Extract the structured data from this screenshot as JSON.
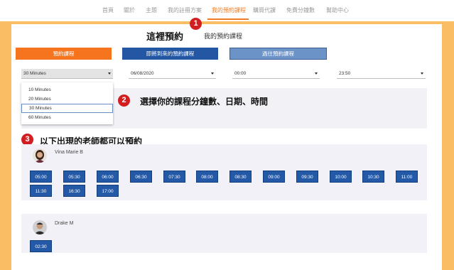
{
  "nav": {
    "items": [
      "首頁",
      "關於",
      "主題",
      "我的註冊方案",
      "我的預約課程",
      "購買代課",
      "免費分鐘數",
      "幫助中心"
    ],
    "active_index": 4,
    "active_color": "#f07d25"
  },
  "markers": [
    "1",
    "2",
    "3"
  ],
  "header": {
    "title": "這裡預約",
    "subtitle": "我的預約課程"
  },
  "tabs": {
    "book": "預約課程",
    "upcoming": "即將到來的預約課程",
    "past": "過往預約課程"
  },
  "filters": {
    "duration": "30 Minutes",
    "date": "06/08/2020",
    "start_time": "00:00",
    "end_time": "23:50",
    "duration_options": [
      "10 Minutes",
      "20 Minutes",
      "30 Minutes",
      "60 Minutes"
    ],
    "selected_option_index": 2
  },
  "annotations": {
    "choose": "選擇你的課程分鐘數、日期、時間",
    "available": "以下出現的老師都可以預約"
  },
  "teachers": [
    {
      "name": "Vina Marie B",
      "slots": [
        "05:00",
        "05:30",
        "06:00",
        "06:30",
        "07:30",
        "08:00",
        "08:30",
        "09:00",
        "09:30",
        "10:00",
        "10:30",
        "11:00",
        "11:30",
        "16:30",
        "17:00"
      ]
    },
    {
      "name": "Drake M",
      "slots": [
        "02:30"
      ]
    }
  ],
  "colors": {
    "page_border": "#fbbd64",
    "primary_orange": "#f7741e",
    "primary_blue": "#2356a3",
    "marker_red": "#d21e21"
  }
}
